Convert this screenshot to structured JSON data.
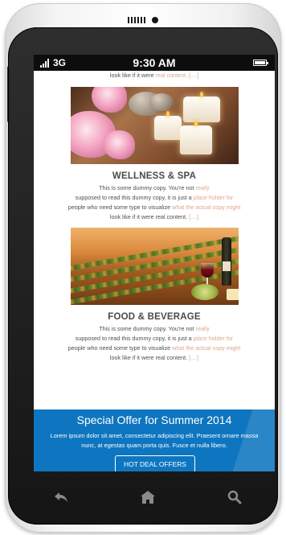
{
  "status_bar": {
    "signal": "3G",
    "time": "9:30 AM"
  },
  "intro": {
    "text_plain": "look like if it were ",
    "text_accent": "real content. [....]"
  },
  "cards": [
    {
      "title": "WELLNESS & SPA",
      "image_subject": "spa flowers, stones and candles",
      "line1": {
        "plain": "This is some dummy copy. You're not ",
        "accent": "really"
      },
      "line2": {
        "plain": "supposed to read this dummy copy, it is just a ",
        "accent": "place holder for"
      },
      "line3": {
        "plain": "people who need some type to visualize ",
        "accent": "what the actual copy might"
      },
      "line4": {
        "plain": "look like if it were real content. ",
        "accent": "[....]"
      }
    },
    {
      "title": "FOOD & BEVERAGE",
      "image_subject": "vineyard with wine, grapes and cheese",
      "line1": {
        "plain": "This is some dummy copy. You're not ",
        "accent": "really"
      },
      "line2": {
        "plain": "supposed to read this dummy copy, it is just a ",
        "accent": "place holder for"
      },
      "line3": {
        "plain": "people who need some type to visualize ",
        "accent": "what the actual copy might"
      },
      "line4": {
        "plain": "look like if it were real content. ",
        "accent": "[....]"
      }
    }
  ],
  "promo": {
    "title": "Special Offer for Summer 2014",
    "text_line1": "Lorem ipsum dolor sit amet, consectetur adipiscing elit. Praesent ornare massa",
    "text_line2": "nunc, at egestas quam porta quis. Fusce et nulla libero.",
    "button_label": "HOT DEAL OFFERS"
  },
  "hardware_keys": [
    "back-icon",
    "home-icon",
    "search-icon"
  ],
  "colors": {
    "promo_blue": "#0e76c0",
    "accent_text": "#e0a78d",
    "body_text": "#4f4f4f"
  }
}
